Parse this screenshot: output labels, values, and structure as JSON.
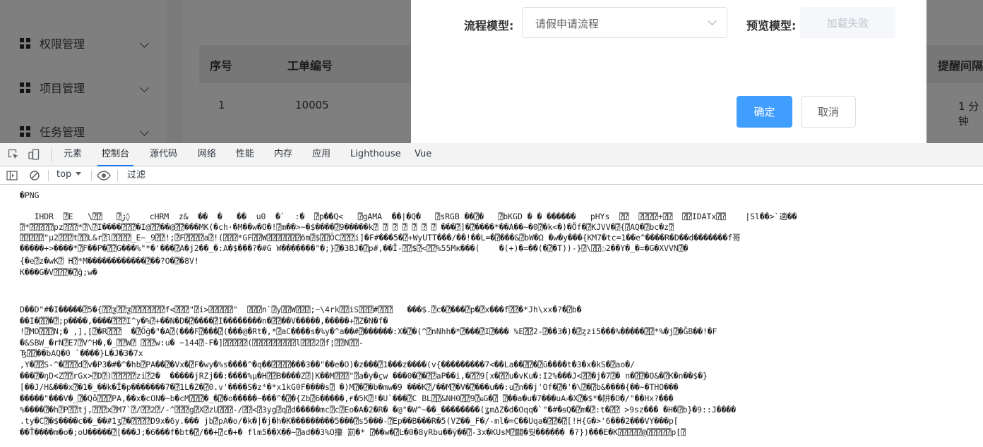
{
  "sidebar": {
    "items": [
      {
        "label": "权限管理"
      },
      {
        "label": "项目管理"
      },
      {
        "label": "任务管理"
      }
    ]
  },
  "table": {
    "headers": [
      "序号",
      "工单编号",
      "提醒间隔"
    ],
    "row": [
      "1",
      "10005",
      "1 分钟"
    ]
  },
  "dialog": {
    "flow_model_label": "流程模型:",
    "flow_model_value": "请假申请流程",
    "preview_label": "预览模型:",
    "preview_status": "加载失败",
    "confirm_label": "确定",
    "cancel_label": "取消"
  },
  "devtools": {
    "tabs": [
      "元素",
      "控制台",
      "源代码",
      "网络",
      "性能",
      "内存",
      "应用",
      "Lighthouse",
      "Vue"
    ],
    "active_tab": "控制台",
    "context": "top",
    "filter_placeholder": "过滤",
    "console_lines": [
      "�PNG",
      "",
      "   IHDR  ⍰E   \\⍰⍰   ⍰ڒ◊    cHRM  z&  ��  �   ��  u0  �`  :�  ⍰p��Q<   ⍰gAMA  ��|�Q�   ⍰sRGB ��⍰�   ⍰bKGD � � ������   pHYs  ⍰⍰  ⍰⍰⍰⍰+⍰⍰  ⍰⍰IDATx⍰⍰    |Sl��>`適��",
      "⍰*⍰⍰⍰⍰⍰pz⍰⍰⍰*⍰\\⍰I����⍰⍰⍰�I@⍰⍰��@⍰⍰���MK(�ch·�M��w�O�!⍰m��>~�$����⍰9�����k⍰ ⍰ ⍰ ⍰ ⍰ ⍰ ⍰ ���⍰]�⍰����*��A��~�0⍰�k<�)�Ŏf�⍰KJVV�⍰{⍰AQ�⍰bc�z⍰",
      "⍰⍰⍰⍰⍰\"μ2⍰⍰⍰t⍰⍰L&r⍰l⍰⍰⍰⍰_E~_9⍰⍰!;⍰F⍰⍰⍰⍰a⍰!(⍰⍰⍰*GF⍰⍰W⍰⍰⍰⍰⍰⍰⍰6m⍰$⍰⍰ÕⅭ⍰⍰⍰i]�F#���5�⍰+WyUTT���/��!��L=�⍰���&⍰bW�Ω �w�y���{KM7�tc=1��e^����R�D��d�������f哥",
      "�����+>����*⍰F��P�⍰⍰G���%\"*�'���⍰A�j2��_�:A�$���?�#G W�������\"�;}⍰�3BJ�⍰p#,��Î-⍰⍰$⍰<⍰⍰%55Mĸ���(    �(+)�=��(�⍰�T))-}⍰\\⍰⍰◌2��Y�_�=�G�XVVN⍰�",
      "{�e⍰z�wK⍰ H⍰*M������������⍰��?O�⍰�8V!",
      "K���G�V⍰⍰⍰�⍰ĝ;w�",
      "",
      "",
      "D��D\"#�I�����⍰5�{⍰⍰ƺ⍰⍰ƺ⍰⍰⍰⍰⍰⍰⍰f<⍰⍰⍰\"⍰i>⍰⍰⍰⍰⍰\"  ⍰⍰⍰n`⍰y⍰⍰W⍰⍰⍰;~\\4rk⍰⍰iS⍰⍰⍰#⍰⍰⍰   ���$.⍰c�⍰���⍰p�⍰x���f⍰⍰�*Jh\\xx�?�⍰b�",
      "��I�⍰⍰�⍰;p����,����⍰⍰⍰I^y�%⍰+��N�D�⍰����⍰I��������n�⍰⍰��V�����,�����+⍰Z�N�f�",
      "!⍰MO⍰⍰⍰N;� ,],[⍰�R⍰⍰⍰  �⍰Ő̈g�\"�A⍰(���F⍰���⍰(���@�Rt�,*⍰aC����s�%y�^a��#⍰������:X�⍰�(^⍰nNhh�*⍰���⍰I⍰��� %E⍰⍰2-⍰��3�)�⍰ȥzi5���%�����⍰⍰*%�j⍰�Ğ̈B��!�F",
      "�&SBW_�rN⍰E7⍰V^H�,�_⍰⍰W⍰ ⍰⍰⍰w:u� ~144⍰-F�]⍰⍰⍰⍰⍰(⍰⍰⍰⍰⍰⍰⍰⍰⍰l⍰⍰⍰2⍰f¦⍰⍰N⍰⍰-",
      "Ꜩ⍰⍰��bAQ�0 `����}L�J�3�7x",
      ",Y�⍰⍰S-^�⍰⍰⍰d⍰v�P3�#�^�hb⍰PA��⍰�Vx�⍰F�wy�%s����^�q��⍰⍰⍰⍰���3��\"��e�O)�z���⍰1���z����(v{���������7<��La��⍰⍰�⍰ū����t�3�x�kS�⍰ao�/",
      "���⍰�ŋD<Z⍰⍰rGx>⍰D⍰)⍰⍰⍰⍰⍰zi⍰2�  �����jRZj��:����%µ�H⍰⍰B����Z⍰|K��M⍰⍰⍰\"⍰a�y�c̱w ���0�⍰�⍰⍰aP��i,�⍰⍰9[x�⍰⍰u�vKu�:I2%���J<⍰⍰�j�7⍰� n�⍰⍰�O&�⍰K�n��$�}",
      "[��J/H&���x⍰�1�_��k�Ĩ�p�������7�⍰1L�Z�⍰0.v'����S�z⁴�*x1kG0F����s⍰ �)M⍰�⍰�b�mw�9 ���K⍰/��M⍰�V�⍰���u��:u⍰n��j'Of�⍰�'�\\⍰�⍰b&����{��~�THO���",
      "�����\"���V�_⍰�Qo̐⍰⍰⍰PA,��x�cON�~b�cM⍰⍰⍰�_�⍰�o�����~���^�⍰�{Zb⍰6�����,ғ�5K⍰!�U`���⍰C BL⍰⍰&NH0⍰⍰9⍰ҩG�⍰ ⍰��a�u�7���uA⸗�X⍰�$*�阱�O�/\"��Hx?���",
      "%����⍰�h⍰P⍰⍰tj,⍰⍰⍰x⍰M7`⍰/⍰⍰2⍰/-^⍰⍰⍰g⍰X⍰zU⍰⍰⍰-/⍰⍰<⍰3yg⍰q⍰d�����mc⍰c⍰Eo�A�2�R� �@\"�W^~��_��������(ʓmΔZ�d�Oqq�`\"�#�ꞩQ�⍰m�⍰:t�⍰⍰ >9sz��� �H�⍰b}�9::J����",
      ".ty�C⍰�$����c��_��#1ʒ⍰�⍰⍰⍰⍰D9x�6y.��� jb⍰pA�o/�k�|�j�h�K���������5���⍰s5���-⍰Ep��B���R�5(VZ��_F�/-ml�=C��Uqa�⍰⍰�⍰[!H{G�>'6���2���VY���p[",
      "��Ť����m�o�;oU�����⍰[���J;�6���f�bt�⍰/��+⍰c�+� flm5��X��~⍰ad��3%O攥 罰�* ⍰��w�⍰Ŀ�0�8yRbu��ÿ��⍰-3x�KUsM⍰闢�뤗������ �?})���E�K⍰⍰⍰⍰⍰@⍰⍰⍰⍰⍰p[⍰"
    ]
  }
}
